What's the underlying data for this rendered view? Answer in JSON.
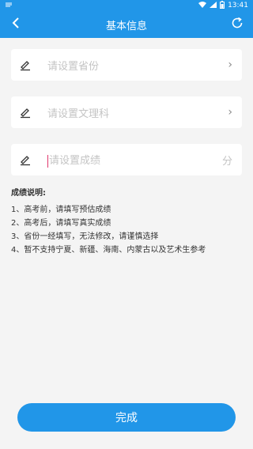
{
  "status_bar": {
    "time": "13:41"
  },
  "header": {
    "title": "基本信息"
  },
  "fields": {
    "province": {
      "placeholder": "请设置省份",
      "chevron": "›"
    },
    "subject": {
      "placeholder": "请设置文理科",
      "chevron": "›"
    },
    "score": {
      "placeholder": "请设置成绩",
      "unit": "分"
    }
  },
  "notes": {
    "title": "成绩说明:",
    "items": [
      "1、高考前，请填写预估成绩",
      "2、高考后，请填写真实成绩",
      "3、省份一经填写，无法修改，请谨慎选择",
      "4、暂不支持宁夏、新疆、海南、内蒙古以及艺术生参考"
    ]
  },
  "done_button": {
    "label": "完成"
  },
  "colors": {
    "primary": "#2196e8",
    "background": "#f4f4f4",
    "placeholder": "#c4c4c4"
  }
}
